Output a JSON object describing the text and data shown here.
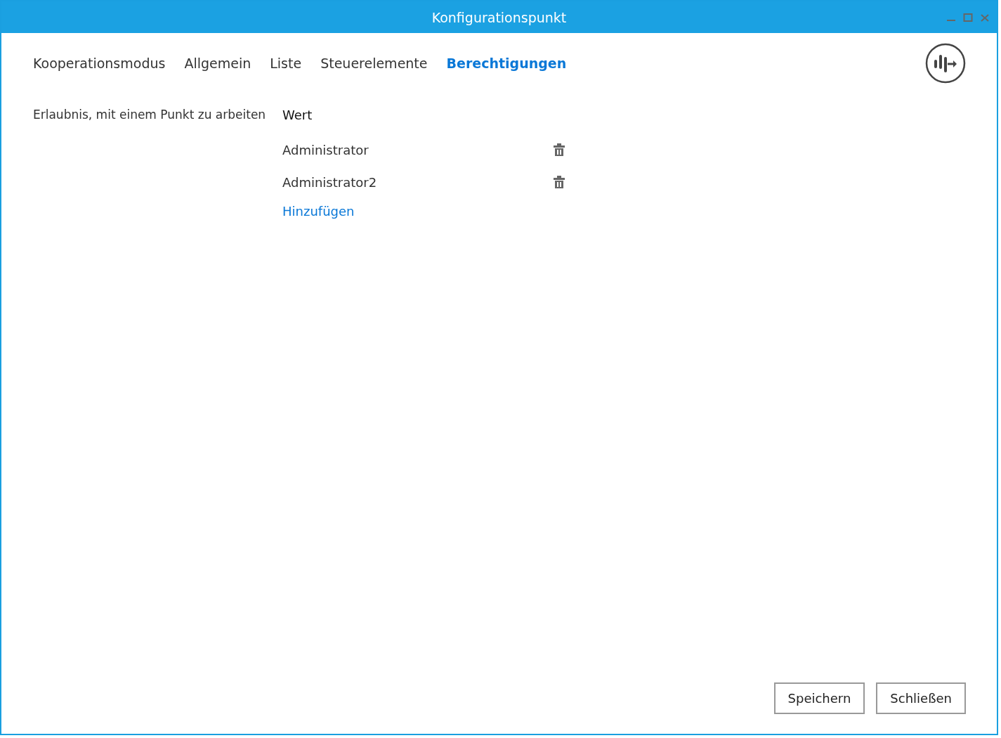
{
  "window": {
    "title": "Konfigurationspunkt"
  },
  "tabs": [
    {
      "label": "Kooperationsmodus",
      "selected": false
    },
    {
      "label": "Allgemein",
      "selected": false
    },
    {
      "label": "Liste",
      "selected": false
    },
    {
      "label": "Steuerelemente",
      "selected": false
    },
    {
      "label": "Berechtigungen",
      "selected": true
    }
  ],
  "permission": {
    "label": "Erlaubnis, mit einem Punkt zu arbeiten",
    "value_header": "Wert",
    "users": [
      "Administrator",
      "Administrator2"
    ],
    "add_link": "Hinzufügen"
  },
  "buttons": [
    "Speichern",
    "Schließen"
  ]
}
